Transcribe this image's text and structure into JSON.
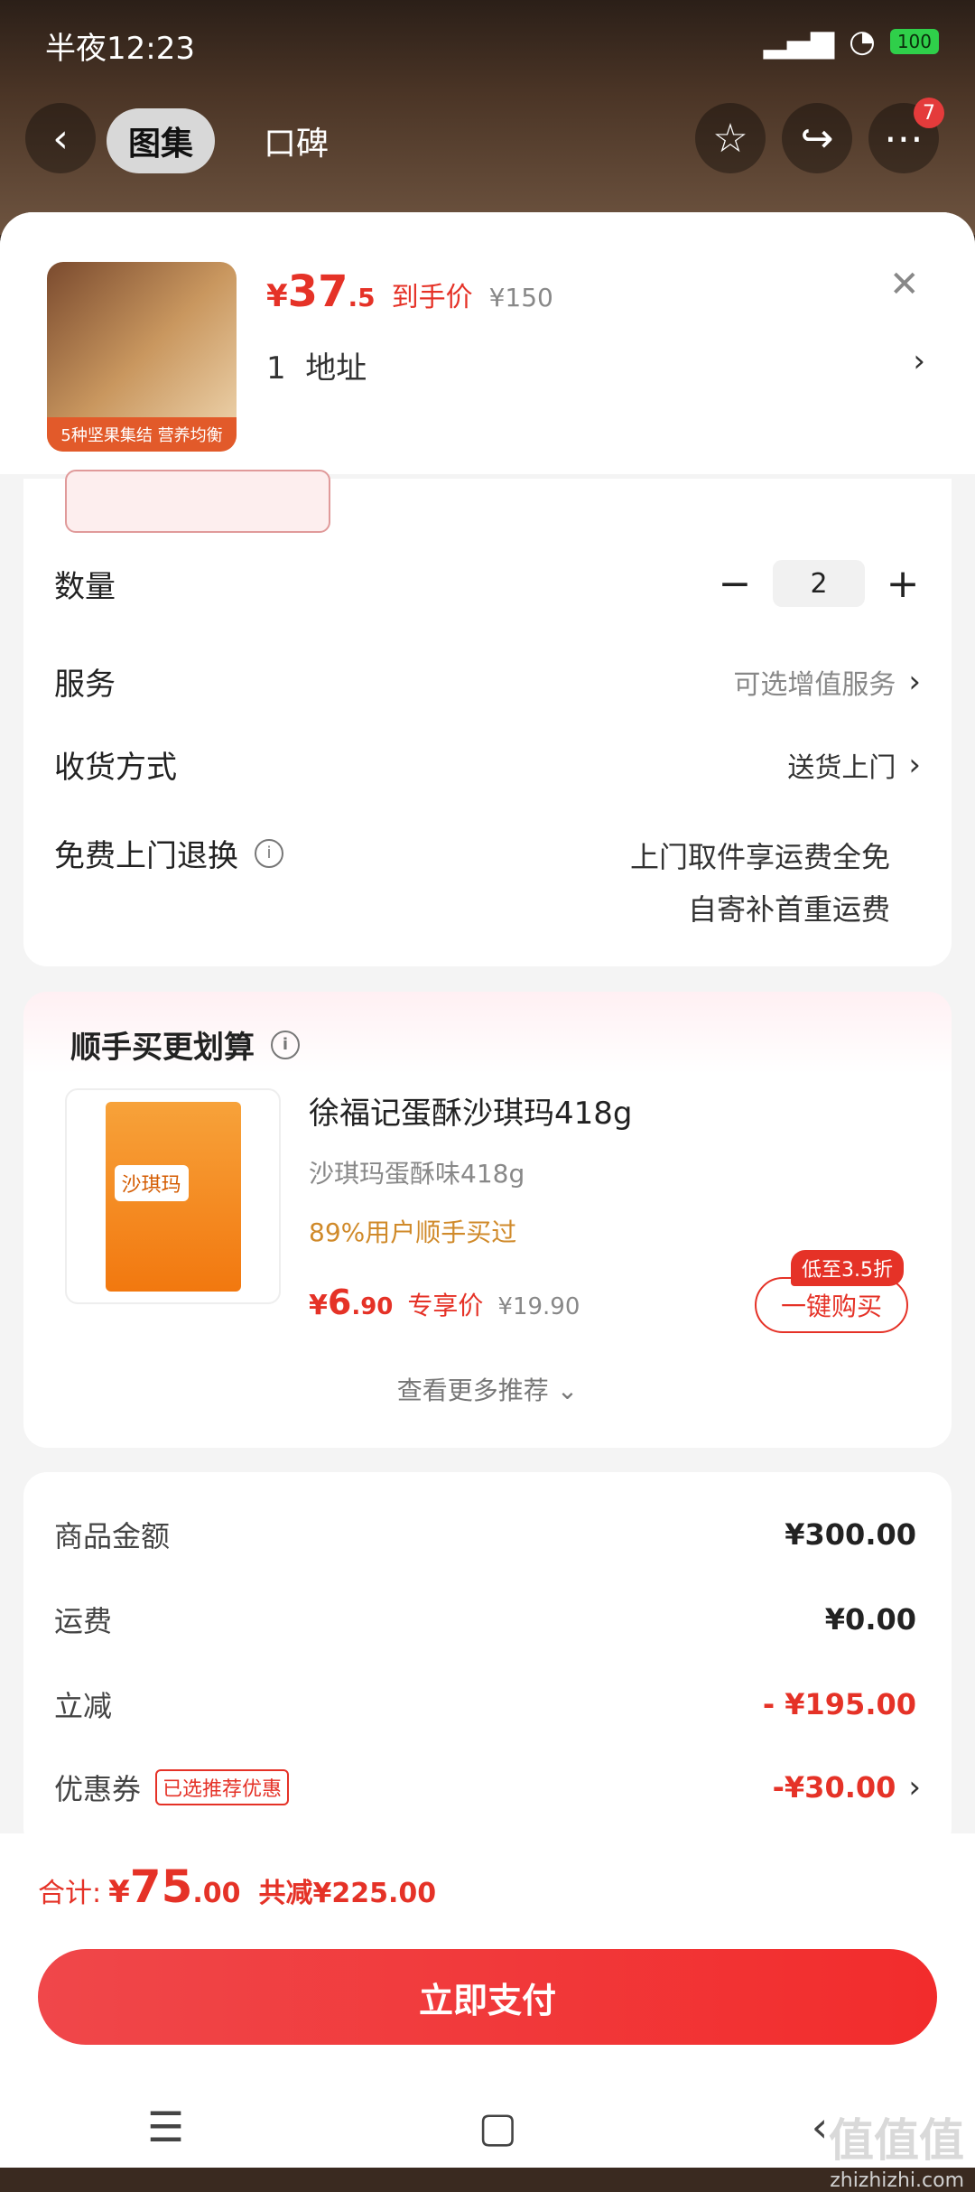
{
  "status_bar": {
    "time": "半夜12:23",
    "battery": "100"
  },
  "top_nav": {
    "tabs": [
      {
        "label": "图集"
      },
      {
        "label": "口碑"
      }
    ],
    "cart_badge": "7"
  },
  "product": {
    "thumb_label": "5种坚果集结 营养均衡",
    "price_currency": "¥",
    "price_int": "37",
    "price_dec": ".5",
    "price_label": "到手价",
    "original_price": "¥150",
    "address_count": "1",
    "address_label": "地址"
  },
  "rows": {
    "quantity": {
      "label": "数量",
      "value": "2"
    },
    "service": {
      "label": "服务",
      "value": "可选增值服务"
    },
    "delivery": {
      "label": "收货方式",
      "value": "送货上门"
    },
    "return": {
      "label": "免费上门退换",
      "line1": "上门取件享运费全免",
      "line2": "自寄补首重运费"
    }
  },
  "recommend": {
    "title": "顺手买更划算",
    "item": {
      "name": "徐福记蛋酥沙琪玛418g",
      "spec": "沙琪玛蛋酥味418g",
      "buy_stat": "89%用户顺手买过",
      "price_currency": "¥",
      "price_int": "6",
      "price_dec": ".90",
      "price_label": "专享价",
      "original_price": "¥19.90",
      "discount_tag": "低至3.5折",
      "buy_button": "一键购买",
      "img_text": "沙琪玛"
    },
    "see_more": "查看更多推荐"
  },
  "summary": {
    "items": [
      {
        "label": "商品金额",
        "value": "¥300.00"
      },
      {
        "label": "运费",
        "value": "¥0.00"
      },
      {
        "label": "立减",
        "value": "- ¥195.00"
      },
      {
        "label": "优惠券",
        "tag": "已选推荐优惠",
        "value": "-¥30.00"
      }
    ]
  },
  "footer": {
    "total_label": "合计:",
    "total_currency": "¥",
    "total_int": "75",
    "total_dec": ".00",
    "saved": "共减¥225.00",
    "pay_button": "立即支付"
  },
  "watermark": {
    "big": "值值值",
    "small": "zhizhizhi.com"
  },
  "colors": {
    "accent": "#e53227",
    "pay_button": "#f0474a"
  }
}
